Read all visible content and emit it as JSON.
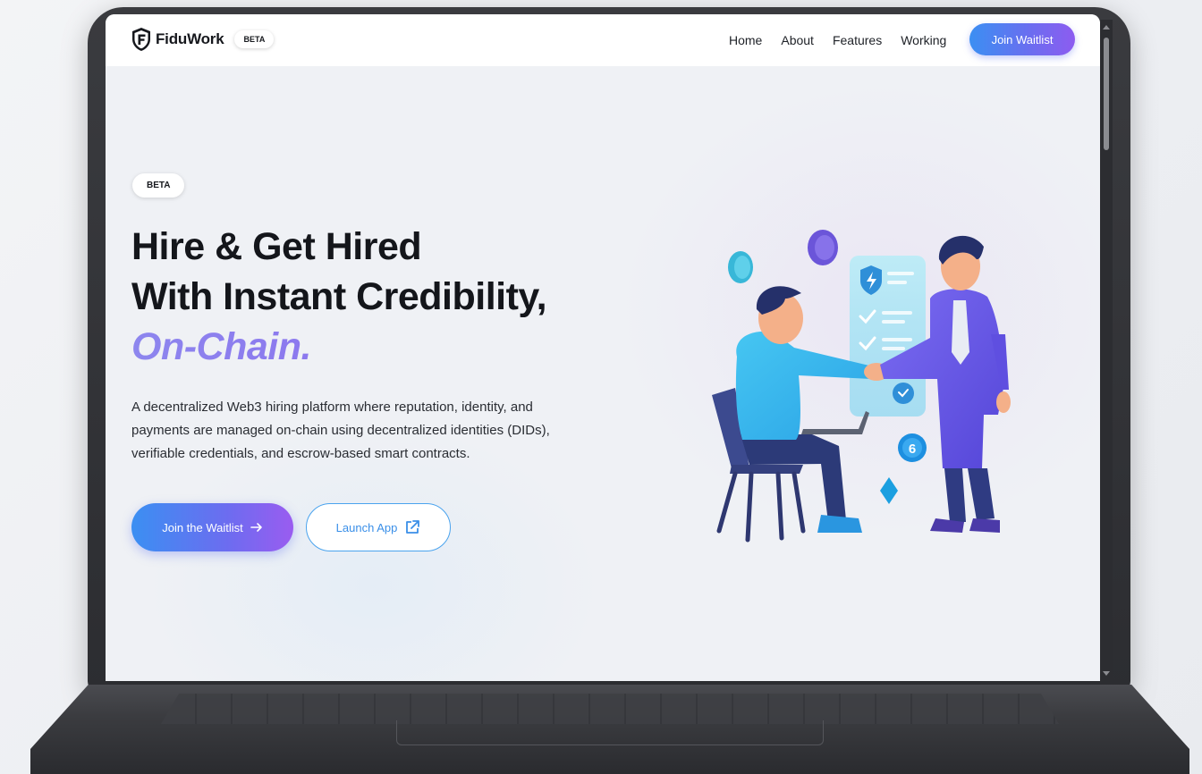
{
  "navbar": {
    "brand_name": "FiduWork",
    "brand_badge": "BETA",
    "links": [
      "Home",
      "About",
      "Features",
      "Working"
    ],
    "cta_label": "Join Waitlist"
  },
  "hero": {
    "badge": "BETA",
    "title_line1": "Hire & Get Hired",
    "title_line2": "With Instant Credibility,",
    "title_accent": "On-Chain.",
    "description": "A decentralized Web3 hiring platform where reputation, identity, and payments are managed on-chain using decentralized identities (DIDs), verifiable credentials, and escrow-based smart contracts.",
    "primary_button": "Join the Waitlist",
    "primary_button_icon": "arrow-right-icon",
    "secondary_button": "Launch App",
    "secondary_button_icon": "external-link-icon"
  },
  "illustration": {
    "coin_label": "6",
    "card_icon": "lightning-shield-icon"
  },
  "colors": {
    "accent_blue": "#3b8ff2",
    "accent_purple": "#8d5cf0",
    "text_dark": "#14161b",
    "screen_bg": "#eff1f5"
  }
}
